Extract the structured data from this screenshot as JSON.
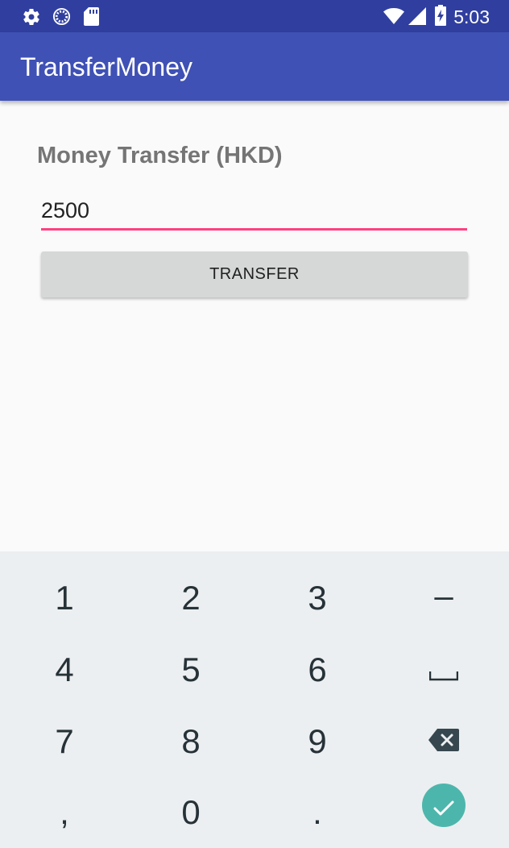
{
  "status_bar": {
    "time": "5:03",
    "icons": [
      "settings-icon",
      "sync-icon",
      "sd-card-icon",
      "wifi-icon",
      "signal-icon",
      "battery-charging-icon"
    ]
  },
  "app_bar": {
    "title": "TransferMoney"
  },
  "form": {
    "heading": "Money Transfer (HKD)",
    "amount_value": "2500",
    "transfer_label": "TRANSFER"
  },
  "keyboard": {
    "rows": [
      [
        "1",
        "2",
        "3",
        "–"
      ],
      [
        "4",
        "5",
        "6",
        "space"
      ],
      [
        "7",
        "8",
        "9",
        "backspace"
      ],
      [
        ",",
        "0",
        ".",
        "done"
      ]
    ],
    "accent": "#4db6ac"
  },
  "colors": {
    "status_bar": "#303f9f",
    "app_bar": "#3f51b5",
    "input_underline": "#ff4081",
    "button_bg": "#d6d7d7"
  }
}
